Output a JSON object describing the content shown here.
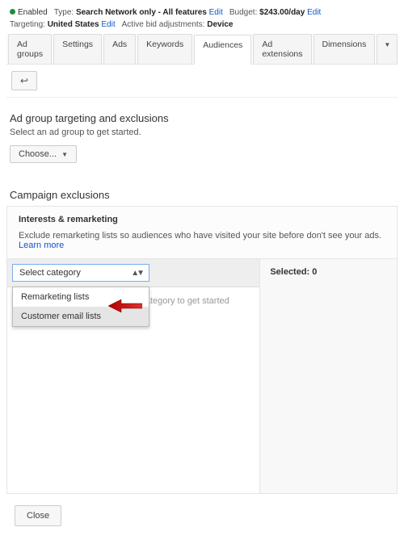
{
  "info": {
    "enabled": "Enabled",
    "type_label": "Type:",
    "type_value": "Search Network only - All features",
    "edit": "Edit",
    "budget_label": "Budget:",
    "budget_value": "$243.00/day",
    "targeting_label": "Targeting:",
    "targeting_value": "United States",
    "active_bid_label": "Active bid adjustments:",
    "active_bid_value": "Device"
  },
  "tabs": {
    "items": [
      {
        "label": "Ad groups"
      },
      {
        "label": "Settings"
      },
      {
        "label": "Ads"
      },
      {
        "label": "Keywords"
      },
      {
        "label": "Audiences"
      },
      {
        "label": "Ad extensions"
      },
      {
        "label": "Dimensions"
      }
    ],
    "active_index": 4
  },
  "back": "↩",
  "targeting": {
    "title": "Ad group targeting and exclusions",
    "subtitle": "Select an ad group to get started.",
    "choose": "Choose..."
  },
  "campaign": {
    "heading": "Campaign exclusions",
    "panel_title": "Interests & remarketing",
    "panel_desc": "Exclude remarketing lists so audiences who have visited your site before don't see your ads. ",
    "learn_more": "Learn more",
    "select_category": "Select category",
    "dropdown": {
      "items": [
        {
          "label": "Remarketing lists"
        },
        {
          "label": "Customer email lists"
        }
      ],
      "highlight_index": 1
    },
    "hint": "ng category to get started",
    "selected_label": "Selected: 0"
  },
  "footer": {
    "close": "Close"
  }
}
